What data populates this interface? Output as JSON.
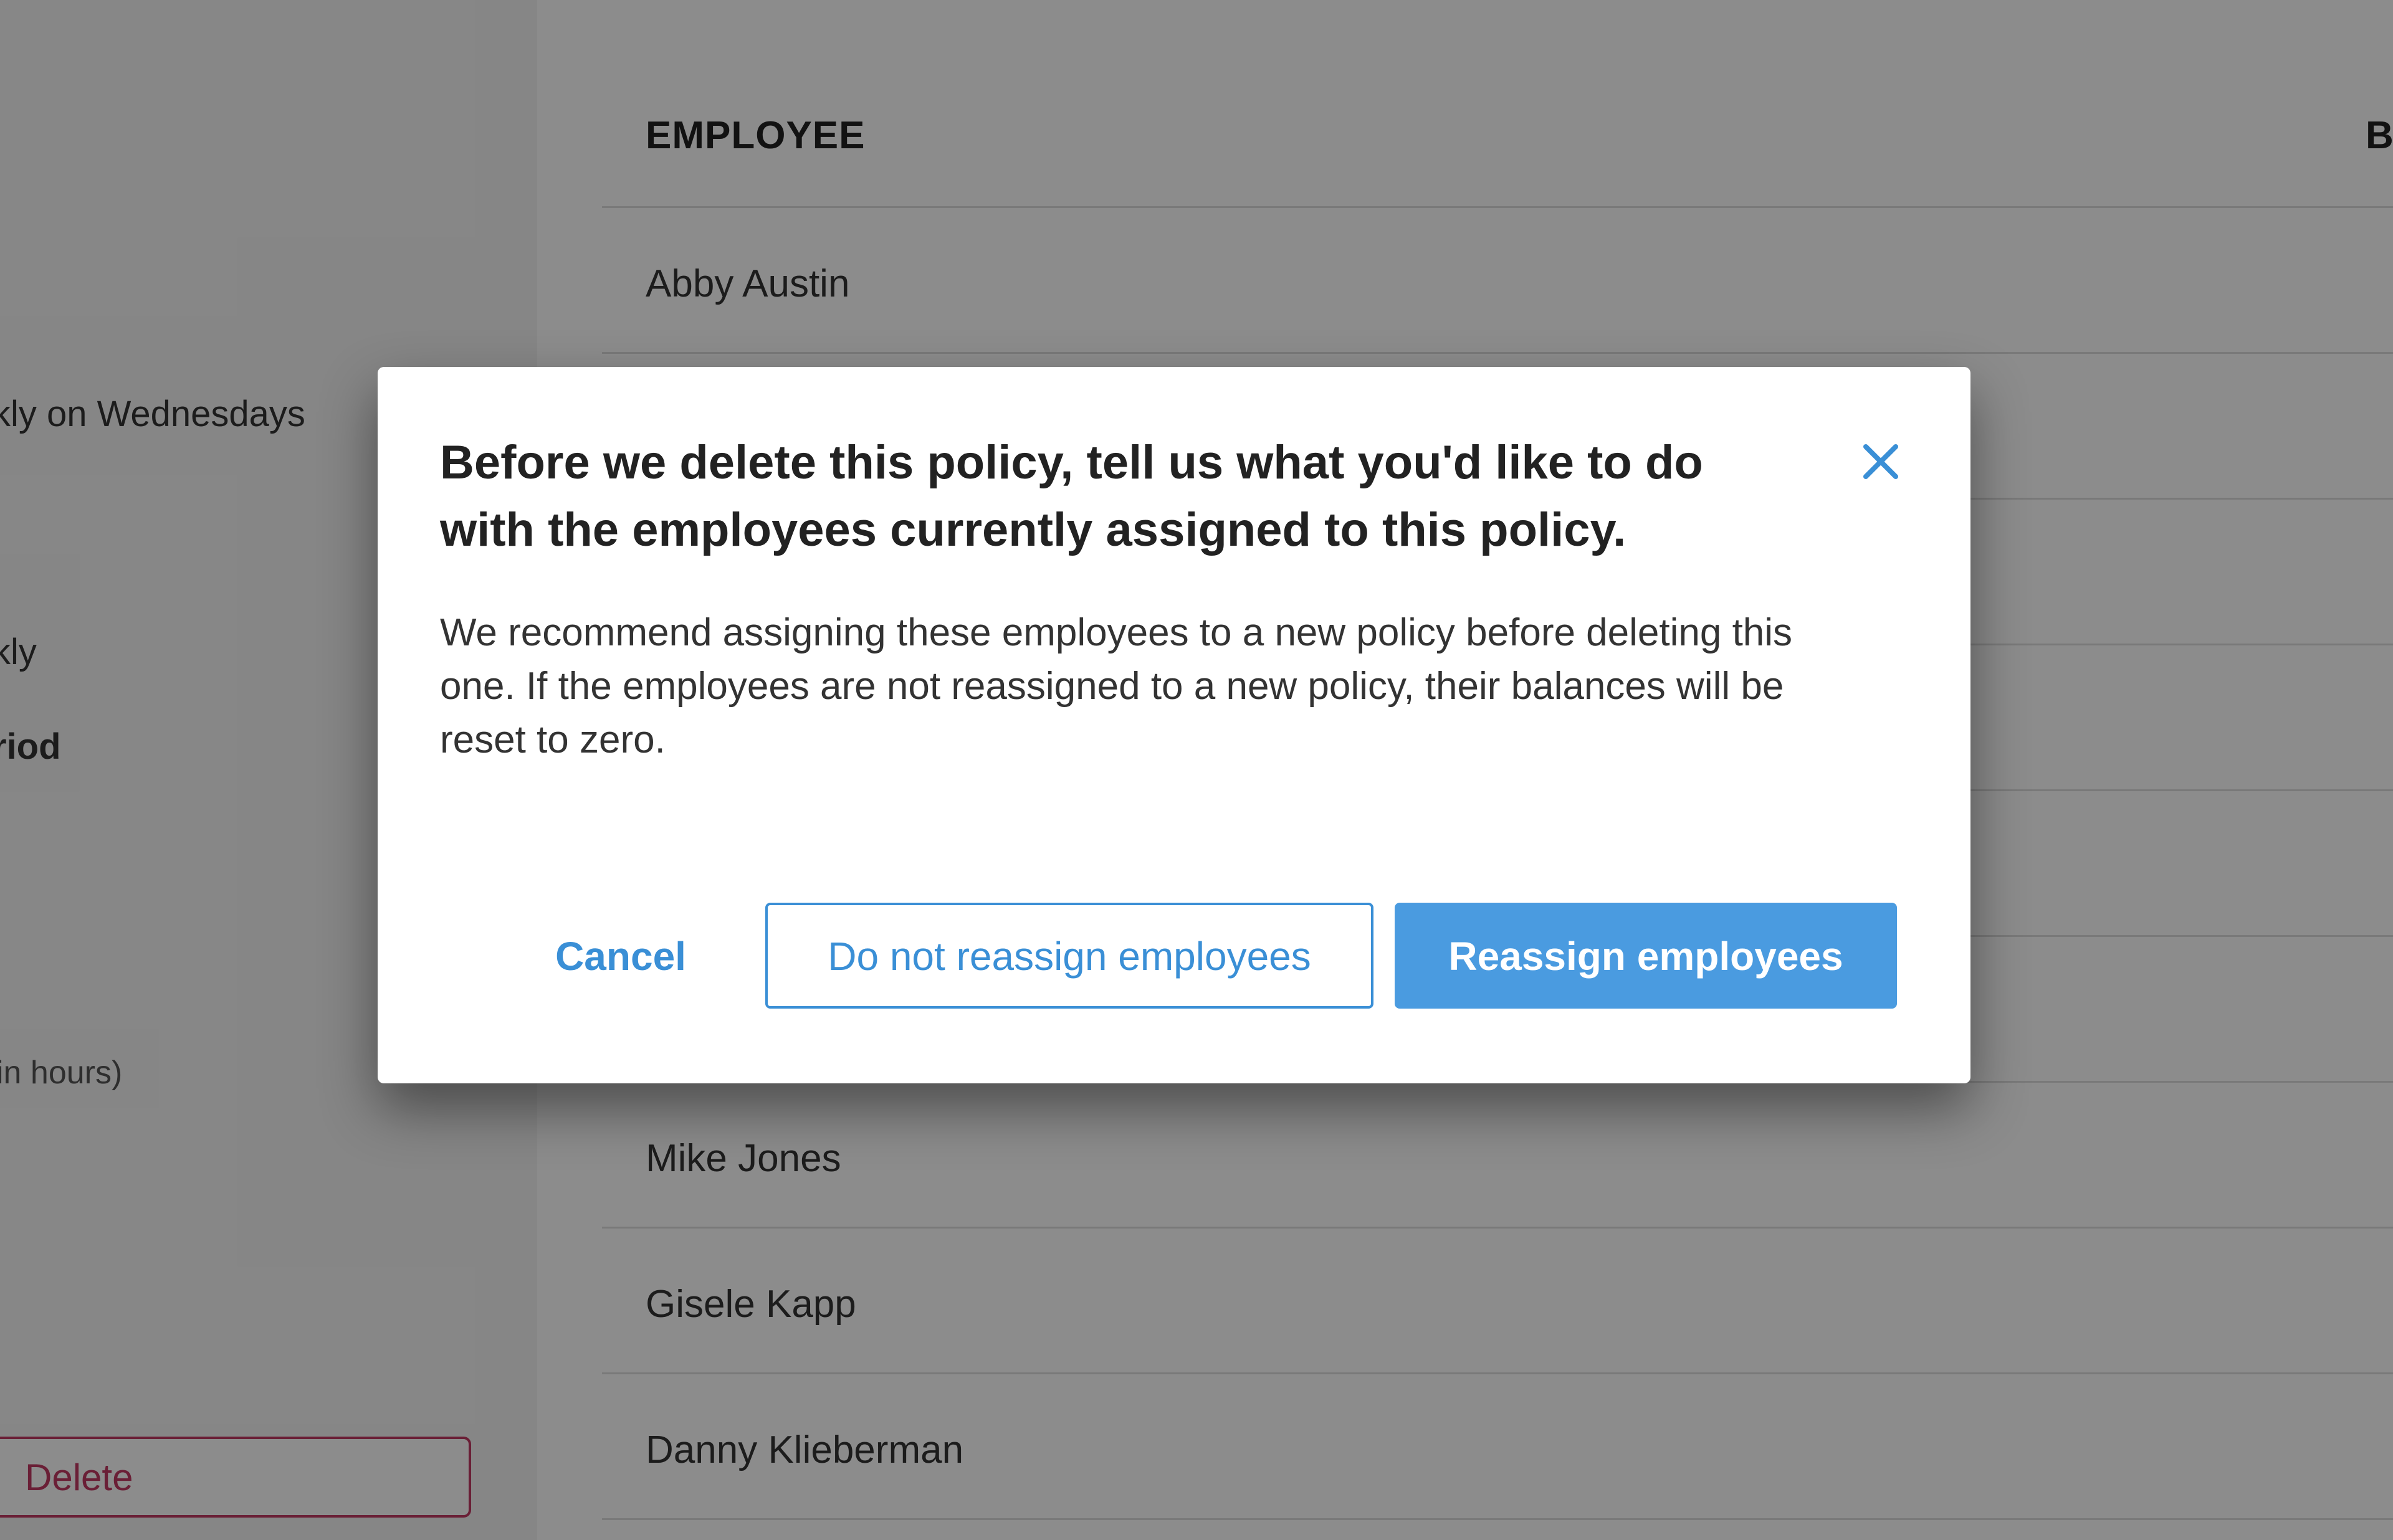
{
  "left_panel": {
    "schedule_text": "kly on Wednesdays",
    "frequency_text": "kly",
    "period_label": "riod",
    "hours_label": "in hours)",
    "delete_label": "Delete"
  },
  "table": {
    "header_employee": "EMPLOYEE",
    "header_balance": "B",
    "rows": [
      {
        "name": "Abby Austin"
      },
      {
        "name": ""
      },
      {
        "name": ""
      },
      {
        "name": ""
      },
      {
        "name": ""
      },
      {
        "name": ""
      },
      {
        "name": "Mike Jones"
      },
      {
        "name": "Gisele Kapp"
      },
      {
        "name": "Danny Klieberman"
      }
    ]
  },
  "modal": {
    "title": "Before we delete this policy, tell us what you'd like to do with the employees currently assigned to this policy.",
    "body": "We recommend assigning these employees to a new policy before deleting this one. If the employees are not reassigned to a new policy, their balances will be reset to zero.",
    "cancel_label": "Cancel",
    "do_not_reassign_label": "Do not reassign employees",
    "reassign_label": "Reassign employees",
    "close_icon": "close-icon"
  },
  "colors": {
    "accent": "#4a9be0",
    "link": "#3a8fd6",
    "danger": "#c23a63",
    "overlay": "rgba(0,0,0,0.45)"
  }
}
